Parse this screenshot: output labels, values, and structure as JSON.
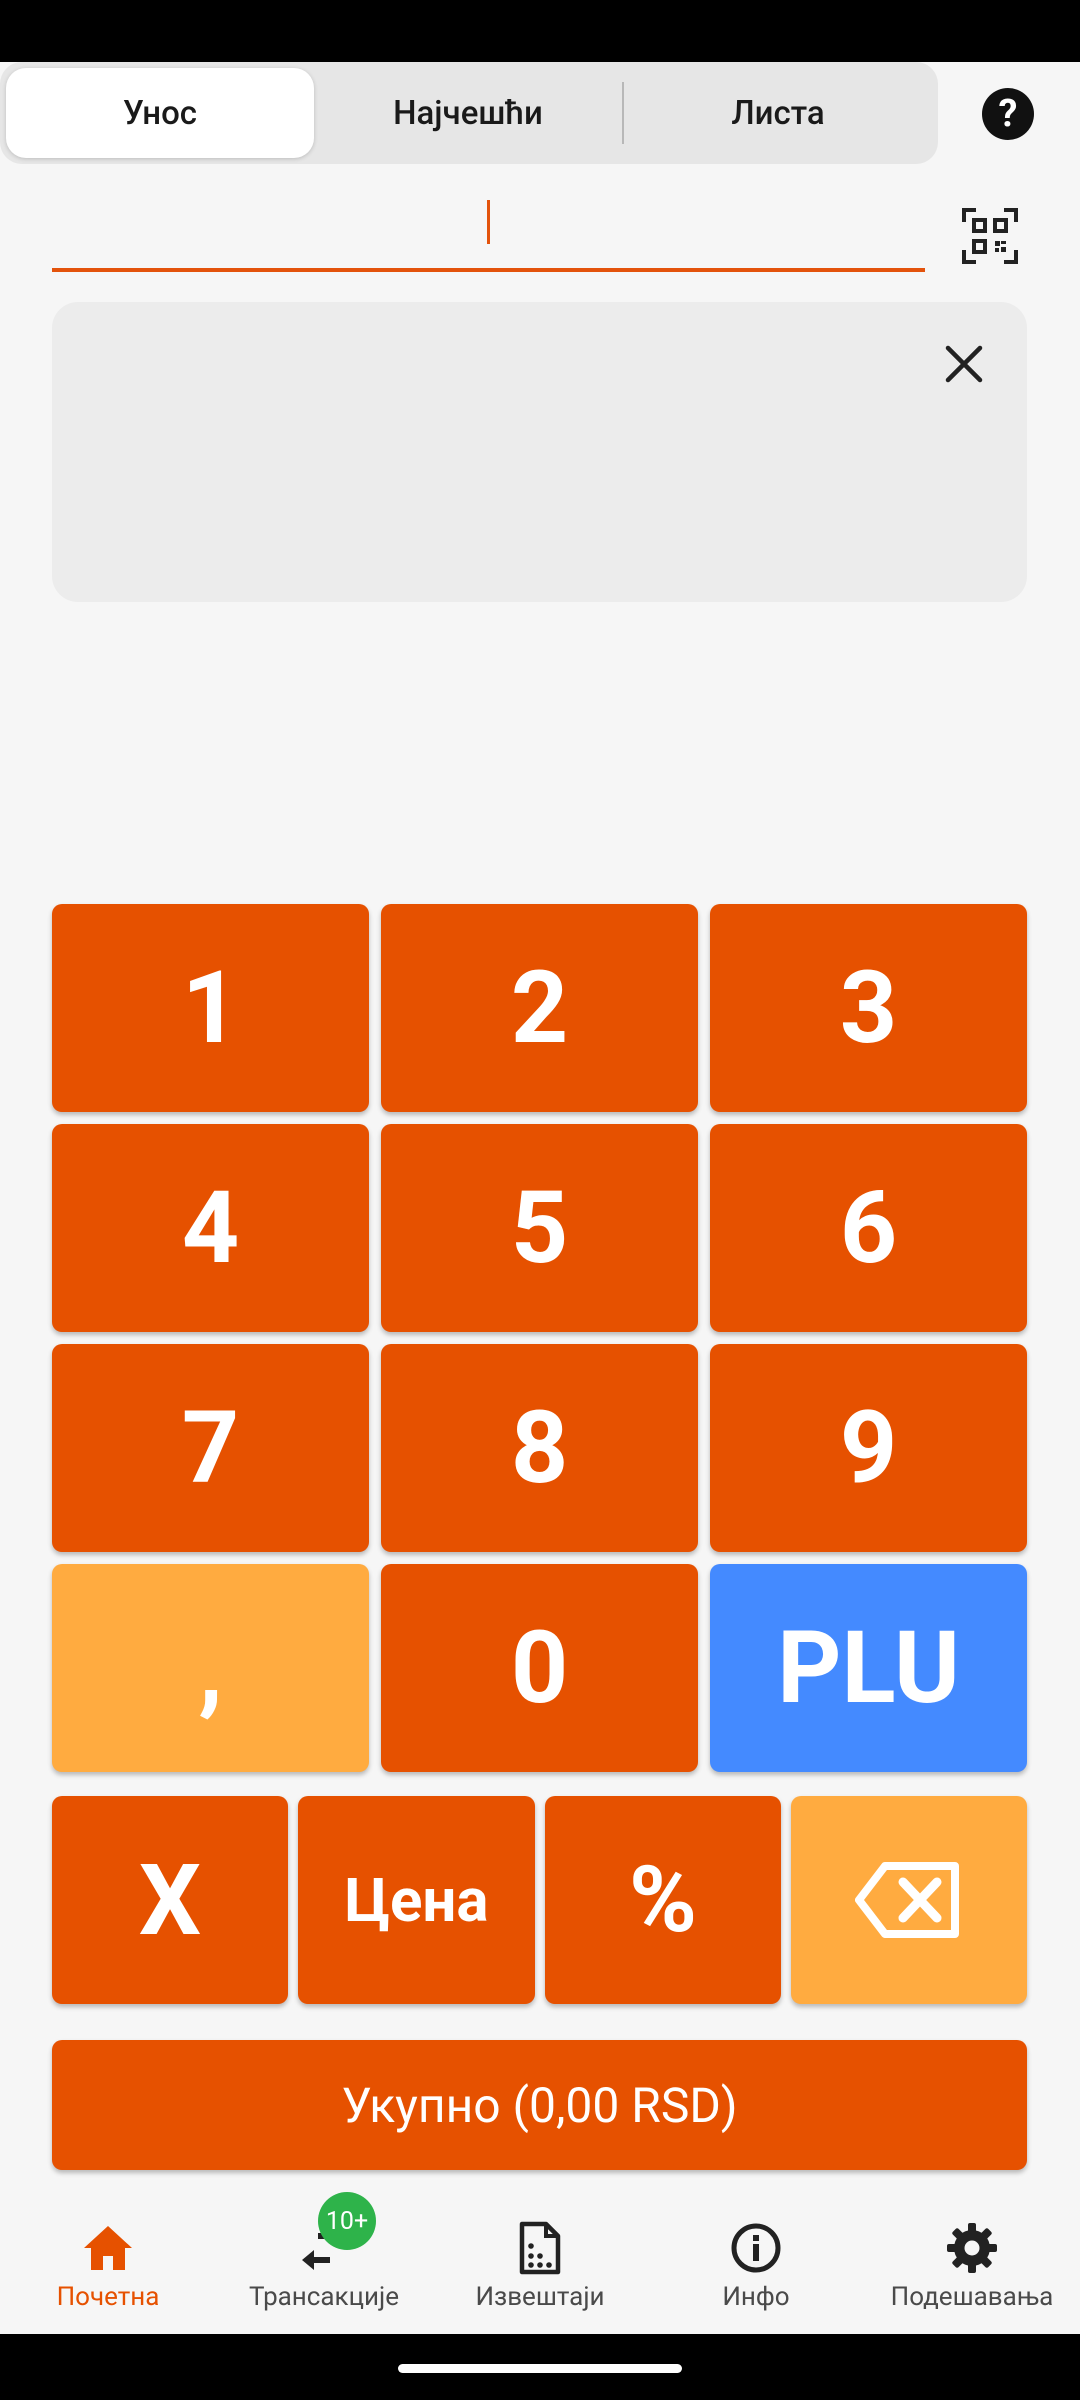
{
  "tabs": [
    {
      "label": "Унос",
      "active": true
    },
    {
      "label": "Најчешћи",
      "active": false
    },
    {
      "label": "Листа",
      "active": false
    }
  ],
  "input": {
    "value": ""
  },
  "keypad": {
    "keys": [
      "1",
      "2",
      "3",
      "4",
      "5",
      "6",
      "7",
      "8",
      "9",
      ",",
      "0",
      "PLU"
    ],
    "function_keys": [
      "X",
      "Цена",
      "%"
    ],
    "backspace_icon": "backspace-icon"
  },
  "total_button": "Укупно (0,00 RSD)",
  "bottom_nav": [
    {
      "label": "Почетна",
      "icon": "home-icon",
      "active": true
    },
    {
      "label": "Трансакције",
      "icon": "transactions-icon",
      "badge": "10+"
    },
    {
      "label": "Извештаји",
      "icon": "reports-icon"
    },
    {
      "label": "Инфо",
      "icon": "info-icon"
    },
    {
      "label": "Подешавања",
      "icon": "settings-icon"
    }
  ],
  "colors": {
    "accent": "#e65100",
    "light_accent": "#ffab40",
    "plu_blue": "#448aff",
    "badge_green": "#2eb34a"
  }
}
